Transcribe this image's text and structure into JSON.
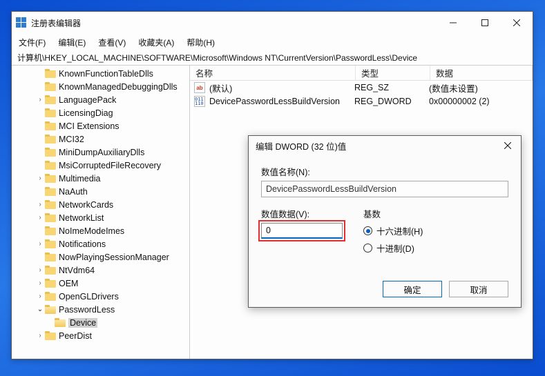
{
  "window": {
    "title": "注册表编辑器",
    "menu": {
      "file": "文件(F)",
      "edit": "编辑(E)",
      "view": "查看(V)",
      "fav": "收藏夹(A)",
      "help": "帮助(H)"
    },
    "address": "计算机\\HKEY_LOCAL_MACHINE\\SOFTWARE\\Microsoft\\Windows NT\\CurrentVersion\\PasswordLess\\Device"
  },
  "tree": {
    "items": [
      {
        "indent": 2,
        "label": "KnownFunctionTableDlls"
      },
      {
        "indent": 2,
        "label": "KnownManagedDebuggingDlls"
      },
      {
        "indent": 2,
        "label": "LanguagePack",
        "caret": "closed"
      },
      {
        "indent": 2,
        "label": "LicensingDiag"
      },
      {
        "indent": 2,
        "label": "MCI Extensions"
      },
      {
        "indent": 2,
        "label": "MCI32"
      },
      {
        "indent": 2,
        "label": "MiniDumpAuxiliaryDlls"
      },
      {
        "indent": 2,
        "label": "MsiCorruptedFileRecovery"
      },
      {
        "indent": 2,
        "label": "Multimedia",
        "caret": "closed"
      },
      {
        "indent": 2,
        "label": "NaAuth"
      },
      {
        "indent": 2,
        "label": "NetworkCards",
        "caret": "closed"
      },
      {
        "indent": 2,
        "label": "NetworkList",
        "caret": "closed"
      },
      {
        "indent": 2,
        "label": "NoImeModeImes"
      },
      {
        "indent": 2,
        "label": "Notifications",
        "caret": "closed"
      },
      {
        "indent": 2,
        "label": "NowPlayingSessionManager"
      },
      {
        "indent": 2,
        "label": "NtVdm64",
        "caret": "closed"
      },
      {
        "indent": 2,
        "label": "OEM",
        "caret": "closed"
      },
      {
        "indent": 2,
        "label": "OpenGLDrivers",
        "caret": "closed"
      },
      {
        "indent": 2,
        "label": "PasswordLess",
        "caret": "open",
        "open": true
      },
      {
        "indent": 3,
        "label": "Device",
        "selected": true,
        "open": true
      },
      {
        "indent": 2,
        "label": "PeerDist",
        "caret": "closed"
      }
    ]
  },
  "list": {
    "head": {
      "name": "名称",
      "type": "类型",
      "data": "数据"
    },
    "rows": [
      {
        "icon": "str",
        "name": "(默认)",
        "type": "REG_SZ",
        "data": "(数值未设置)"
      },
      {
        "icon": "dw",
        "name": "DevicePasswordLessBuildVersion",
        "type": "REG_DWORD",
        "data": "0x00000002 (2)"
      }
    ]
  },
  "dialog": {
    "title": "编辑 DWORD (32 位)值",
    "name_label": "数值名称(N):",
    "name_value": "DevicePasswordLessBuildVersion",
    "value_label": "数值数据(V):",
    "value_value": "0",
    "base_label": "基数",
    "hex_label": "十六进制(H)",
    "dec_label": "十进制(D)",
    "ok": "确定",
    "cancel": "取消"
  }
}
